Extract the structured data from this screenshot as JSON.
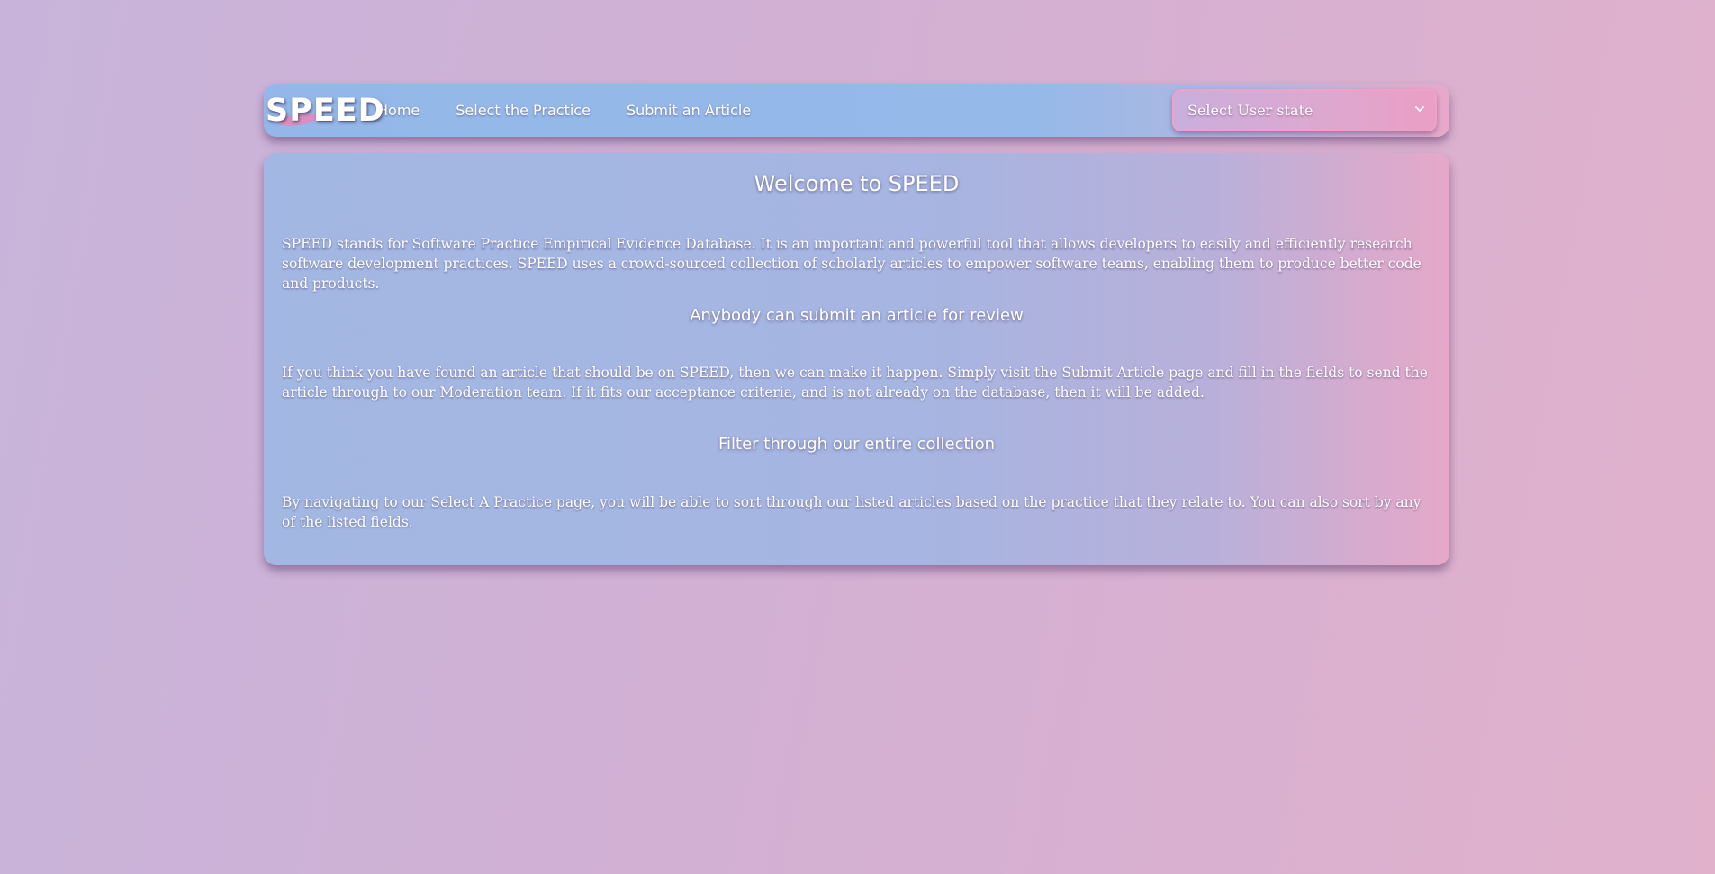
{
  "nav": {
    "logo": "SPEED",
    "links": [
      {
        "label": "Home"
      },
      {
        "label": "Select the Practice"
      },
      {
        "label": "Submit an Article"
      }
    ],
    "user_state_select": {
      "selected": "Select User state",
      "chevron_icon": "chevron-down-icon"
    }
  },
  "main": {
    "title": "Welcome to SPEED",
    "intro": "SPEED stands for Software Practice Empirical Evidence Database. It is an important and powerful tool that allows developers to easily and efficiently research software development practices. SPEED uses a crowd-sourced collection of scholarly articles to empower software teams, enabling them to produce better code and products.",
    "section1": {
      "heading": "Anybody can submit an article for review",
      "text": "If you think you have found an article that should be on SPEED, then we can make it happen. Simply visit the Submit Article page and fill in the fields to send the article through to our Moderation team. If it fits our acceptance criteria, and is not already on the database, then it will be added."
    },
    "section2": {
      "heading": "Filter through our entire collection",
      "text": "By navigating to our Select A Practice page, you will be able to sort through our listed articles based on the practice that they relate to. You can also sort by any of the listed fields."
    }
  },
  "colors": {
    "navbar": "#95b9e9",
    "content": "#a6b5e1",
    "accent_pink": "#e9a8c9",
    "background": "#d2b0d4"
  }
}
